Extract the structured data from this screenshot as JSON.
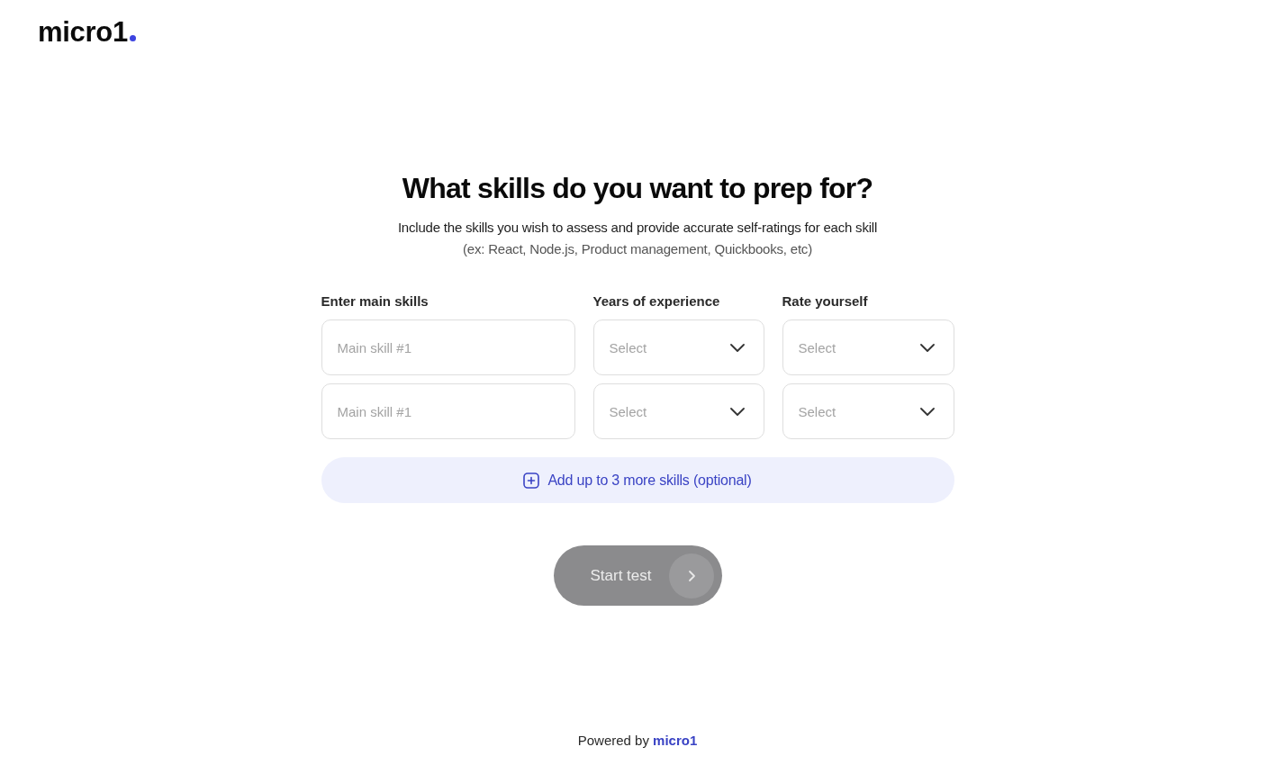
{
  "logo": {
    "text": "micro1"
  },
  "heading": "What skills do you want to prep for?",
  "description": [
    "Include the skills you wish to assess and provide accurate self-ratings for each skill",
    "(ex: React, Node.js, Product management, Quickbooks, etc)"
  ],
  "columns": [
    "Enter main skills",
    "Years of experience",
    "Rate yourself"
  ],
  "rows": [
    {
      "skill": {
        "placeholder": "Main skill #1"
      },
      "years": {
        "placeholder": "Select"
      },
      "rating": {
        "placeholder": "Select"
      }
    },
    {
      "skill": {
        "placeholder": "Main skill #1"
      },
      "years": {
        "placeholder": "Select"
      },
      "rating": {
        "placeholder": "Select"
      }
    }
  ],
  "add_button": {
    "label": "Add up to 3 more skills (optional)"
  },
  "start_button": {
    "label": "Start test",
    "disabled": true
  },
  "footer": {
    "text": "Powered by",
    "link": "micro1"
  }
}
